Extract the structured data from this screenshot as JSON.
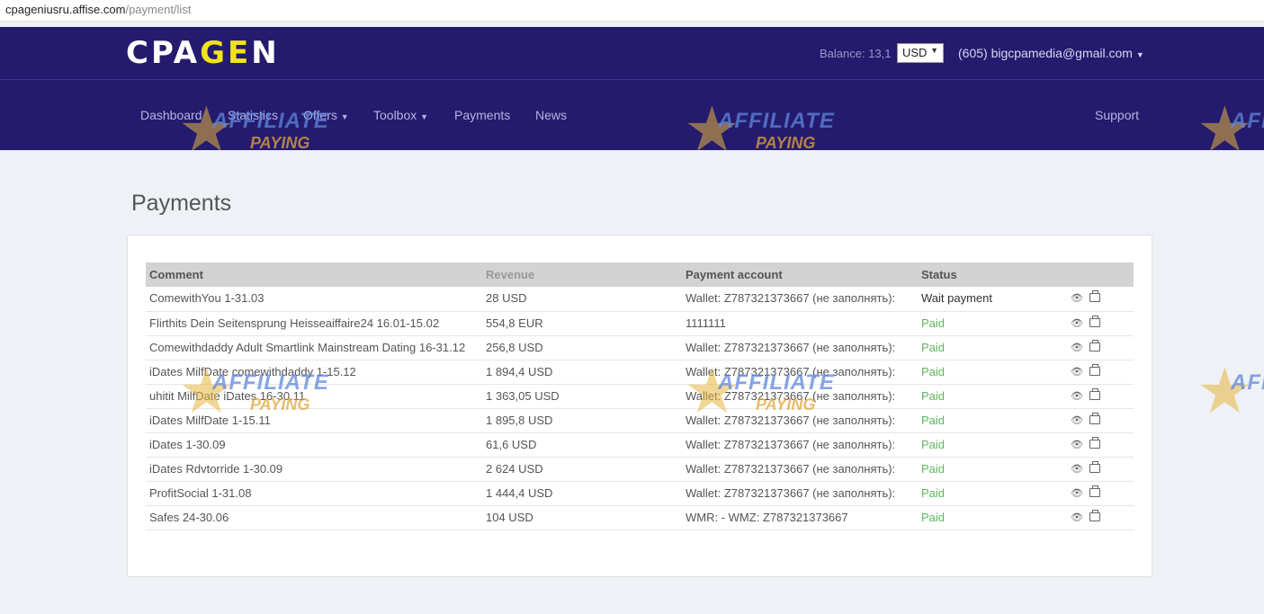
{
  "browser": {
    "url_host": "cpageniusru.affise.com",
    "url_path": "/payment/list"
  },
  "header": {
    "logo_white_1": "CPA",
    "logo_yellow": "GE",
    "logo_white_2": "N",
    "balance_label": "Balance: 13,1",
    "currency": "USD",
    "account": "(605) bigcpamedia@gmail.com"
  },
  "nav": {
    "dashboard": "Dashboard",
    "statistics": "Statistics",
    "offers": "Offers",
    "toolbox": "Toolbox",
    "payments": "Payments",
    "news": "News",
    "support": "Support"
  },
  "watermark": {
    "line1": "AFFILIATE",
    "line2": "PAYING"
  },
  "page": {
    "title": "Payments"
  },
  "table": {
    "headers": {
      "comment": "Comment",
      "revenue": "Revenue",
      "account": "Payment account",
      "status": "Status"
    },
    "rows": [
      {
        "comment": "ComewithYou 1-31.03",
        "revenue": "28 USD",
        "account": "Wallet: Z787321373667 (не заполнять):",
        "status": "Wait payment"
      },
      {
        "comment": "Flirthits Dein Seitensprung Heisseaiffaire24 16.01-15.02",
        "revenue": "554,8 EUR",
        "account": "1111111",
        "status": "Paid"
      },
      {
        "comment": "Comewithdaddy Adult Smartlink Mainstream Dating 16-31.12",
        "revenue": "256,8 USD",
        "account": "Wallet: Z787321373667 (не заполнять):",
        "status": "Paid"
      },
      {
        "comment": "iDates MilfDate comewithdaddy 1-15.12",
        "revenue": "1 894,4 USD",
        "account": "Wallet: Z787321373667 (не заполнять):",
        "status": "Paid"
      },
      {
        "comment": "uhitit MilfDate iDates 16-30.11",
        "revenue": "1 363,05 USD",
        "account": "Wallet: Z787321373667 (не заполнять):",
        "status": "Paid"
      },
      {
        "comment": "iDates MilfDate 1-15.11",
        "revenue": "1 895,8 USD",
        "account": "Wallet: Z787321373667 (не заполнять):",
        "status": "Paid"
      },
      {
        "comment": "iDates 1-30.09",
        "revenue": "61,6 USD",
        "account": "Wallet: Z787321373667 (не заполнять):",
        "status": "Paid"
      },
      {
        "comment": "iDates Rdvtorride 1-30.09",
        "revenue": "2 624 USD",
        "account": "Wallet: Z787321373667 (не заполнять):",
        "status": "Paid"
      },
      {
        "comment": "ProfitSocial 1-31.08",
        "revenue": "1 444,4 USD",
        "account": "Wallet: Z787321373667 (не заполнять):",
        "status": "Paid"
      },
      {
        "comment": "Safes 24-30.06",
        "revenue": "104 USD",
        "account": "WMR: - WMZ: Z787321373667",
        "status": "Paid"
      }
    ]
  },
  "colors": {
    "nav_bg": "#241b6e",
    "logo_yellow": "#f2e31a",
    "paid": "#5cb85c",
    "page_bg": "#eef1f5"
  },
  "icons": {
    "view": "eye-icon",
    "print": "printer-icon",
    "dropdown": "caret-down-icon",
    "watermark": "star-icon"
  }
}
